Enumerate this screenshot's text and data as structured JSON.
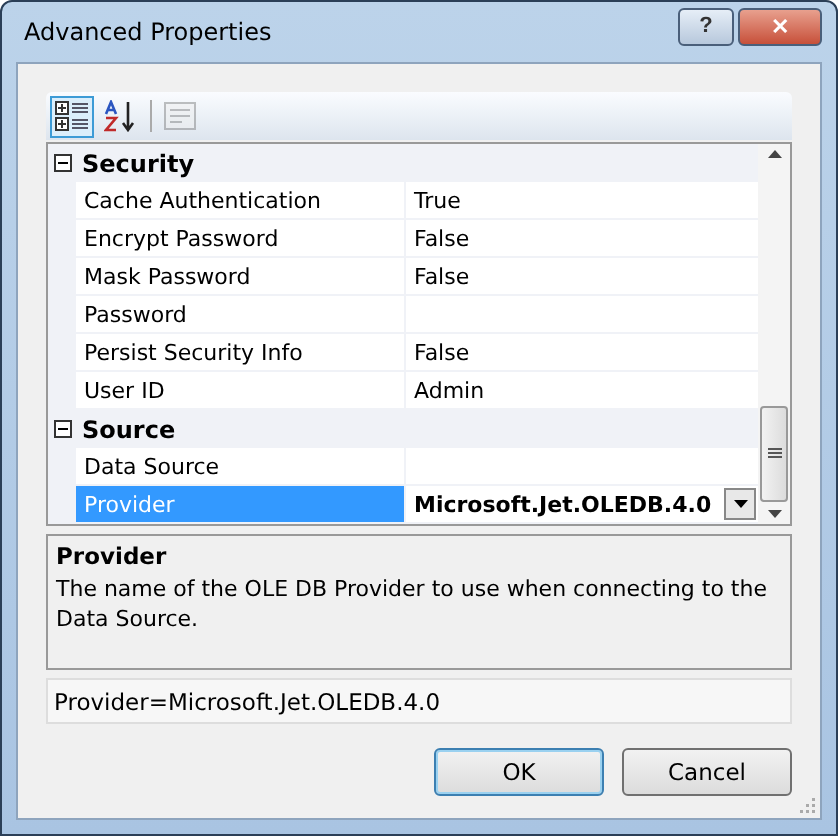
{
  "window": {
    "title": "Advanced Properties",
    "buttons": [
      {
        "kind": "help",
        "label": "?"
      },
      {
        "kind": "close",
        "label": "✕"
      }
    ]
  },
  "toolbar": [
    {
      "kind": "categorized",
      "selected": true
    },
    {
      "kind": "alphabetical",
      "selected": false
    },
    {
      "kind": "pages",
      "selected": false,
      "disabled": true
    }
  ],
  "categories": [
    {
      "name": "Security",
      "expanded": true,
      "properties": [
        {
          "name": "Cache Authentication",
          "value": "True",
          "modified": false,
          "selected": false
        },
        {
          "name": "Encrypt Password",
          "value": "False",
          "modified": false,
          "selected": false
        },
        {
          "name": "Mask Password",
          "value": "False",
          "modified": false,
          "selected": false
        },
        {
          "name": "Password",
          "selected": false
        },
        {
          "name": "Persist Security Info",
          "value": "False",
          "modified": false,
          "selected": false
        },
        {
          "name": "User ID",
          "value": "Admin",
          "modified": false,
          "selected": false
        }
      ]
    },
    {
      "name": "Source",
      "expanded": true,
      "properties": [
        {
          "name": "Data Source",
          "selected": false
        },
        {
          "name": "Provider",
          "value": "Microsoft.Jet.OLEDB.4.0",
          "modified": true,
          "selected": true
        }
      ]
    }
  ],
  "description": {
    "title": "Provider",
    "text": "The name of the OLE DB Provider to use when connecting to the Data Source."
  },
  "connection_string": "Provider=Microsoft.Jet.OLEDB.4.0",
  "buttons": [
    {
      "label": "OK",
      "default": true
    },
    {
      "label": "Cancel",
      "default": false
    }
  ]
}
